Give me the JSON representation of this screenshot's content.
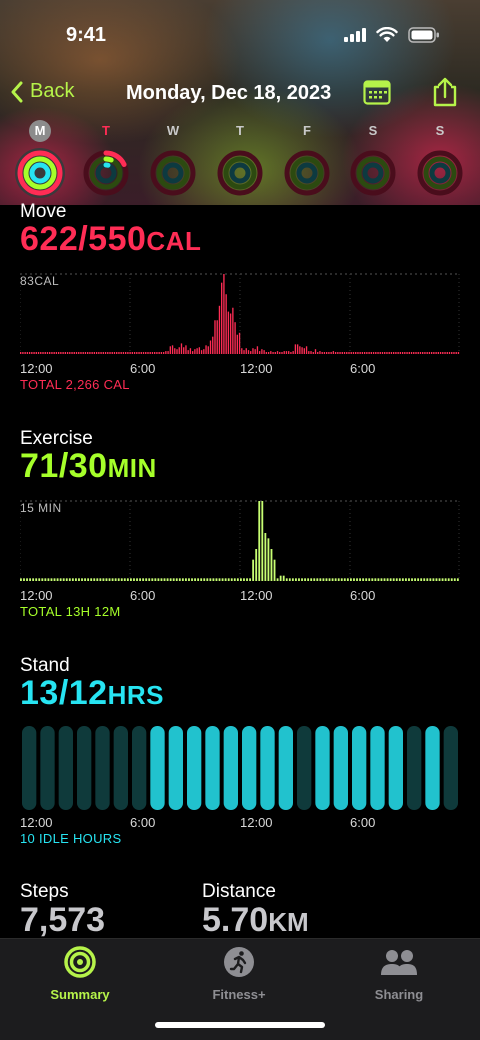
{
  "status_bar": {
    "time": "9:41"
  },
  "nav": {
    "back_label": "Back",
    "title": "Monday, Dec 18, 2023"
  },
  "week": [
    {
      "letter": "M",
      "state": "selected",
      "move": 1.13,
      "exercise": 1.0,
      "stand": 1.0
    },
    {
      "letter": "T",
      "state": "today",
      "move": 0.18,
      "exercise": 0.06,
      "stand": 0.04
    },
    {
      "letter": "W",
      "state": "",
      "move": 0,
      "exercise": 0,
      "stand": 0
    },
    {
      "letter": "T",
      "state": "",
      "move": 0,
      "exercise": 0,
      "stand": 0
    },
    {
      "letter": "F",
      "state": "",
      "move": 0,
      "exercise": 0,
      "stand": 0
    },
    {
      "letter": "S",
      "state": "",
      "move": 0,
      "exercise": 0,
      "stand": 0
    },
    {
      "letter": "S",
      "state": "",
      "move": 0,
      "exercise": 0,
      "stand": 0
    }
  ],
  "colors": {
    "move": "#ff2d55",
    "exercise": "#a6ff2a",
    "stand": "#27e4f2",
    "accent": "#b6f34a"
  },
  "move": {
    "title": "Move",
    "value": "622/550",
    "unit": "CAL",
    "max_label": "83CAL",
    "total": "TOTAL 2,266 CAL",
    "axis": [
      "12:00",
      "6:00",
      "12:00",
      "6:00"
    ],
    "max_value": 83,
    "bars": [
      2,
      2,
      2,
      2,
      2,
      2,
      2,
      2,
      2,
      2,
      2,
      2,
      2,
      2,
      2,
      2,
      2,
      2,
      2,
      2,
      2,
      2,
      2,
      2,
      2,
      2,
      2,
      2,
      2,
      2,
      2,
      2,
      2,
      2,
      2,
      2,
      2,
      2,
      2,
      2,
      2,
      2,
      2,
      2,
      2,
      2,
      2,
      2,
      2,
      2,
      2,
      2,
      2,
      2,
      2,
      2,
      2,
      2,
      2,
      2,
      2,
      2,
      2,
      2,
      2,
      3,
      3,
      8,
      9,
      6,
      5,
      7,
      11,
      7,
      9,
      4,
      6,
      3,
      5,
      6,
      7,
      4,
      5,
      9,
      8,
      14,
      18,
      35,
      35,
      50,
      74,
      83,
      62,
      44,
      42,
      48,
      33,
      20,
      22,
      6,
      4,
      6,
      4,
      3,
      6,
      5,
      8,
      3,
      5,
      4,
      2,
      2,
      3,
      2,
      2,
      3,
      2,
      2,
      3,
      3,
      3,
      2,
      3,
      10,
      10,
      8,
      7,
      6,
      8,
      3,
      3,
      2,
      5,
      2,
      3,
      2,
      2,
      2,
      2,
      2,
      3,
      2,
      2,
      2,
      2,
      2,
      2,
      2,
      2,
      2,
      2,
      2,
      2,
      2,
      2,
      2,
      2,
      2,
      2,
      2,
      2,
      2,
      2,
      2,
      2,
      2,
      2,
      2,
      2,
      2,
      2,
      2,
      2,
      2,
      2,
      2,
      2,
      2,
      2,
      2,
      2,
      2,
      2,
      2,
      2,
      2,
      2,
      2,
      2,
      2,
      2,
      2,
      2,
      2,
      2,
      2,
      2
    ]
  },
  "exercise": {
    "title": "Exercise",
    "value": "71/30",
    "unit": "MIN",
    "max_label": "15 MIN",
    "total": "TOTAL 13H 12M",
    "axis": [
      "12:00",
      "6:00",
      "12:00",
      "6:00"
    ],
    "max_value": 15,
    "bars": [
      0.5,
      0.5,
      0.5,
      0.5,
      0.5,
      0.5,
      0.5,
      0.5,
      0.5,
      0.5,
      0.5,
      0.5,
      0.5,
      0.5,
      0.5,
      0.5,
      0.5,
      0.5,
      0.5,
      0.5,
      0.5,
      0.5,
      0.5,
      0.5,
      0.5,
      0.5,
      0.5,
      0.5,
      0.5,
      0.5,
      0.5,
      0.5,
      0.5,
      0.5,
      0.5,
      0.5,
      0.5,
      0.5,
      0.5,
      0.5,
      0.5,
      0.5,
      0.5,
      0.5,
      0.5,
      0.5,
      0.5,
      0.5,
      0.5,
      0.5,
      0.5,
      0.5,
      0.5,
      0.5,
      0.5,
      0.5,
      0.5,
      0.5,
      0.5,
      0.5,
      0.5,
      0.5,
      0.5,
      0.5,
      0.5,
      0.5,
      0.5,
      0.5,
      0.5,
      0.5,
      0.5,
      0.5,
      0.5,
      0.5,
      0.5,
      0.5,
      0.5,
      0.5,
      0.5,
      0.5,
      0.5,
      0.5,
      0.5,
      0.5,
      0.5,
      0.5,
      0.5,
      0.5,
      0.5,
      0.5,
      0.5,
      0.5,
      0.5,
      0.5,
      0.5,
      0.5,
      0.5,
      0.5,
      0.5,
      0.5,
      0.5,
      0.5,
      0.5,
      0.5,
      0.5,
      0.5,
      0.5,
      0.5,
      0.5,
      0.5,
      0.5,
      0.5,
      0.5,
      0.5,
      0.5,
      0.5,
      0.5,
      0.5,
      0.5,
      0.5,
      0.5,
      0.5,
      0.5,
      0.5,
      0.5,
      0.5,
      0.5,
      0.5,
      0.5,
      0.5,
      0.5,
      0.5,
      0.5,
      0.5,
      0.5,
      0.5,
      0.5,
      0.5,
      0.5,
      0.5,
      0.5,
      0.5,
      0.5,
      0.5
    ],
    "peak_bars": [
      [
        76,
        4
      ],
      [
        77,
        6
      ],
      [
        78,
        15
      ],
      [
        79,
        15
      ],
      [
        80,
        9
      ],
      [
        81,
        8
      ],
      [
        82,
        6
      ],
      [
        83,
        4
      ],
      [
        85,
        1
      ],
      [
        86,
        1
      ]
    ]
  },
  "stand": {
    "title": "Stand",
    "value": "13/12",
    "unit": "HRS",
    "idle": "10 IDLE HOURS",
    "axis": [
      "12:00",
      "6:00",
      "12:00",
      "6:00"
    ],
    "hours": [
      0,
      0,
      0,
      0,
      0,
      0,
      0,
      1,
      1,
      1,
      1,
      1,
      1,
      1,
      1,
      0,
      1,
      1,
      1,
      1,
      1,
      0,
      1,
      0
    ]
  },
  "steps": {
    "label": "Steps",
    "value": "7,573"
  },
  "distance": {
    "label": "Distance",
    "value": "5.70",
    "unit": "KM"
  },
  "tabs": [
    {
      "label": "Summary",
      "icon": "activity-rings-icon",
      "active": true
    },
    {
      "label": "Fitness+",
      "icon": "running-figure-icon",
      "active": false
    },
    {
      "label": "Sharing",
      "icon": "people-icon",
      "active": false
    }
  ]
}
